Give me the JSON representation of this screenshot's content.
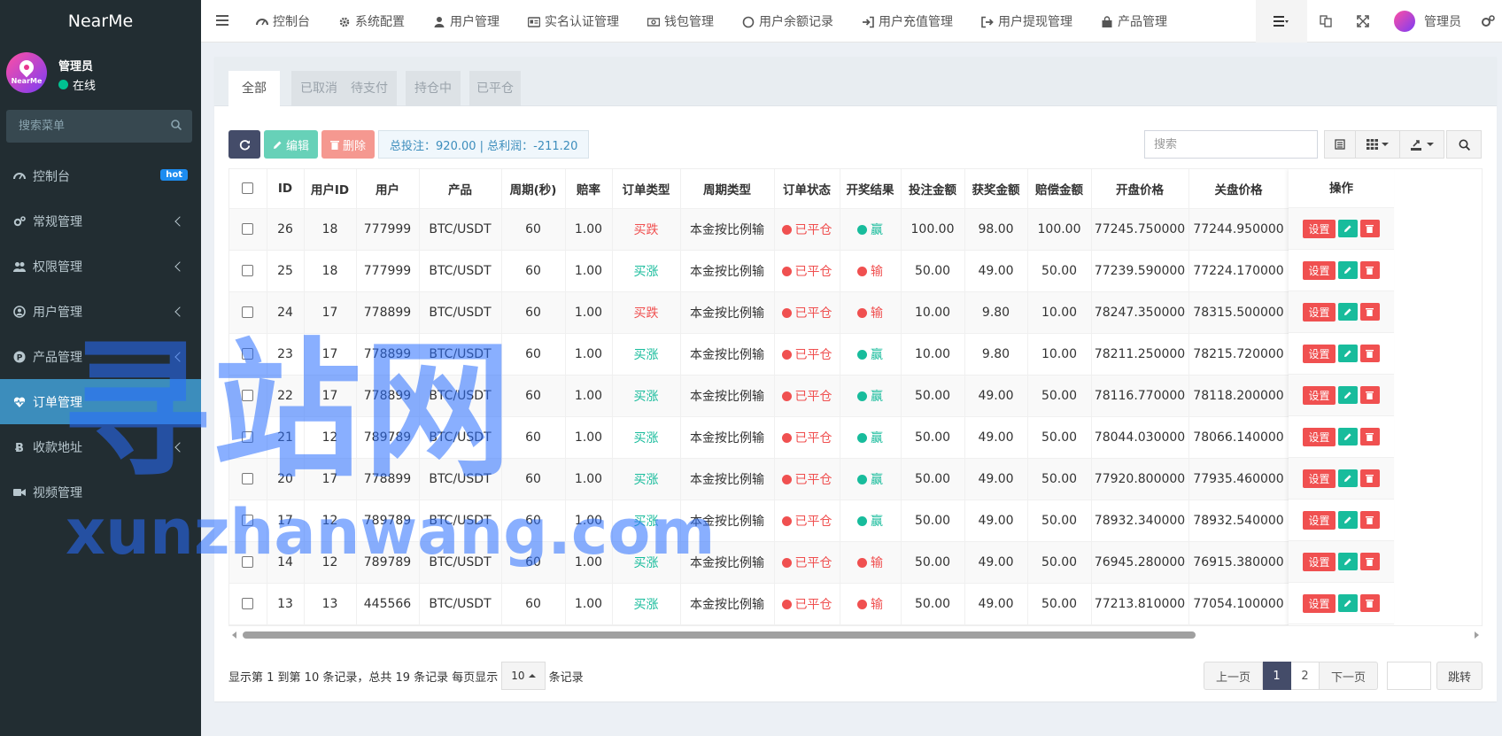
{
  "brand": "NearMe",
  "avatar_text": "NearMe",
  "user": {
    "name": "管理员",
    "status": "在线"
  },
  "sidebar": {
    "search_placeholder": "搜索菜单",
    "items": [
      {
        "label": "控制台",
        "badge": "hot",
        "icon": "dashboard-icon"
      },
      {
        "label": "常规管理",
        "icon": "cogs-icon"
      },
      {
        "label": "权限管理",
        "icon": "users-icon"
      },
      {
        "label": "用户管理",
        "icon": "user-circle-icon"
      },
      {
        "label": "产品管理",
        "icon": "product-p-icon"
      },
      {
        "label": "订单管理",
        "icon": "heartbeat-icon",
        "active": true
      },
      {
        "label": "收款地址",
        "icon": "bitcoin-icon"
      },
      {
        "label": "视频管理",
        "icon": "video-icon"
      }
    ]
  },
  "topnav": [
    {
      "label": "控制台",
      "icon": "dashboard-icon"
    },
    {
      "label": "系统配置",
      "icon": "gear-icon"
    },
    {
      "label": "用户管理",
      "icon": "user-icon"
    },
    {
      "label": "实名认证管理",
      "icon": "id-card-icon"
    },
    {
      "label": "钱包管理",
      "icon": "money-icon"
    },
    {
      "label": "用户余额记录",
      "icon": "circle-icon"
    },
    {
      "label": "用户充值管理",
      "icon": "sign-in-icon"
    },
    {
      "label": "用户提现管理",
      "icon": "sign-out-icon"
    },
    {
      "label": "产品管理",
      "icon": "shopping-bag-icon"
    }
  ],
  "topright": {
    "user_label": "管理员"
  },
  "tabs": [
    "全部",
    "已取消",
    "待支付",
    "持仓中",
    "已平仓"
  ],
  "toolbar": {
    "edit_label": "编辑",
    "delete_label": "删除",
    "summary": "总投注：920.00 | 总利润：-211.20",
    "search_placeholder": "搜索"
  },
  "table": {
    "columns": [
      "ID",
      "用户ID",
      "用户",
      "产品",
      "周期(秒)",
      "赔率",
      "订单类型",
      "周期类型",
      "订单状态",
      "开奖结果",
      "投注金额",
      "获奖金额",
      "赔偿金额",
      "开盘价格",
      "关盘价格"
    ],
    "ops_header": "操作",
    "ops": {
      "set_label": "设置"
    },
    "rows": [
      {
        "id": "26",
        "uid": "18",
        "user": "777999",
        "product": "BTC/USDT",
        "period": "60",
        "odds": "1.00",
        "otype": "买跌",
        "otype_color": "red",
        "ptype": "本金按比例输",
        "status": "已平仓",
        "result": "赢",
        "result_color": "green",
        "bet": "100.00",
        "win": "98.00",
        "comp": "100.00",
        "open": "77245.750000",
        "close": "77244.950000"
      },
      {
        "id": "25",
        "uid": "18",
        "user": "777999",
        "product": "BTC/USDT",
        "period": "60",
        "odds": "1.00",
        "otype": "买涨",
        "otype_color": "green",
        "ptype": "本金按比例输",
        "status": "已平仓",
        "result": "输",
        "result_color": "red",
        "bet": "50.00",
        "win": "49.00",
        "comp": "50.00",
        "open": "77239.590000",
        "close": "77224.170000"
      },
      {
        "id": "24",
        "uid": "17",
        "user": "778899",
        "product": "BTC/USDT",
        "period": "60",
        "odds": "1.00",
        "otype": "买跌",
        "otype_color": "red",
        "ptype": "本金按比例输",
        "status": "已平仓",
        "result": "输",
        "result_color": "red",
        "bet": "10.00",
        "win": "9.80",
        "comp": "10.00",
        "open": "78247.350000",
        "close": "78315.500000"
      },
      {
        "id": "23",
        "uid": "17",
        "user": "778899",
        "product": "BTC/USDT",
        "period": "60",
        "odds": "1.00",
        "otype": "买涨",
        "otype_color": "green",
        "ptype": "本金按比例输",
        "status": "已平仓",
        "result": "赢",
        "result_color": "green",
        "bet": "10.00",
        "win": "9.80",
        "comp": "10.00",
        "open": "78211.250000",
        "close": "78215.720000"
      },
      {
        "id": "22",
        "uid": "17",
        "user": "778899",
        "product": "BTC/USDT",
        "period": "60",
        "odds": "1.00",
        "otype": "买涨",
        "otype_color": "green",
        "ptype": "本金按比例输",
        "status": "已平仓",
        "result": "赢",
        "result_color": "green",
        "bet": "50.00",
        "win": "49.00",
        "comp": "50.00",
        "open": "78116.770000",
        "close": "78118.200000"
      },
      {
        "id": "21",
        "uid": "12",
        "user": "789789",
        "product": "BTC/USDT",
        "period": "60",
        "odds": "1.00",
        "otype": "买涨",
        "otype_color": "green",
        "ptype": "本金按比例输",
        "status": "已平仓",
        "result": "赢",
        "result_color": "green",
        "bet": "50.00",
        "win": "49.00",
        "comp": "50.00",
        "open": "78044.030000",
        "close": "78066.140000"
      },
      {
        "id": "20",
        "uid": "17",
        "user": "778899",
        "product": "BTC/USDT",
        "period": "60",
        "odds": "1.00",
        "otype": "买涨",
        "otype_color": "green",
        "ptype": "本金按比例输",
        "status": "已平仓",
        "result": "赢",
        "result_color": "green",
        "bet": "50.00",
        "win": "49.00",
        "comp": "50.00",
        "open": "77920.800000",
        "close": "77935.460000"
      },
      {
        "id": "17",
        "uid": "12",
        "user": "789789",
        "product": "BTC/USDT",
        "period": "60",
        "odds": "1.00",
        "otype": "买涨",
        "otype_color": "green",
        "ptype": "本金按比例输",
        "status": "已平仓",
        "result": "赢",
        "result_color": "green",
        "bet": "50.00",
        "win": "49.00",
        "comp": "50.00",
        "open": "78932.340000",
        "close": "78932.540000"
      },
      {
        "id": "14",
        "uid": "12",
        "user": "789789",
        "product": "BTC/USDT",
        "period": "60",
        "odds": "1.00",
        "otype": "买涨",
        "otype_color": "green",
        "ptype": "本金按比例输",
        "status": "已平仓",
        "result": "输",
        "result_color": "red",
        "bet": "50.00",
        "win": "49.00",
        "comp": "50.00",
        "open": "76945.280000",
        "close": "76915.380000"
      },
      {
        "id": "13",
        "uid": "13",
        "user": "445566",
        "product": "BTC/USDT",
        "period": "60",
        "odds": "1.00",
        "otype": "买涨",
        "otype_color": "green",
        "ptype": "本金按比例输",
        "status": "已平仓",
        "result": "输",
        "result_color": "red",
        "bet": "50.00",
        "win": "49.00",
        "comp": "50.00",
        "open": "77213.810000",
        "close": "77054.100000"
      }
    ]
  },
  "pagination": {
    "info_prefix": "显示第 1 到第 10 条记录，总共 19 条记录 每页显示",
    "page_size": "10",
    "info_suffix": "条记录",
    "prev": "上一页",
    "pages": [
      "1",
      "2"
    ],
    "current": "1",
    "next": "下一页",
    "jump": "跳转"
  },
  "watermark": {
    "cn": "寻站网",
    "en": "xunzhanwang.com"
  },
  "colors": {
    "sidebar_bg": "#222d32",
    "active": "#3c8dbc",
    "red": "#f05050",
    "green": "#18bc9c",
    "dark_btn": "#444c69"
  }
}
